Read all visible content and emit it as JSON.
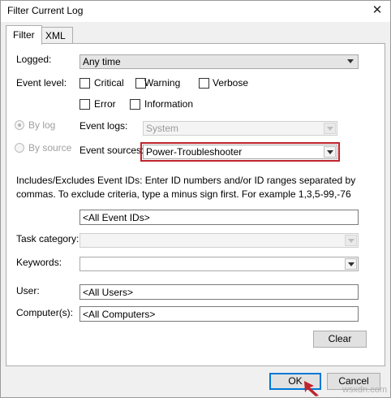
{
  "window": {
    "title": "Filter Current Log"
  },
  "tabs": [
    {
      "label": "Filter"
    },
    {
      "label": "XML"
    }
  ],
  "filter": {
    "logged": {
      "label": "Logged:",
      "value": "Any time"
    },
    "event_level": {
      "label": "Event level:",
      "options": [
        {
          "label": "Critical",
          "checked": false
        },
        {
          "label": "Warning",
          "checked": false
        },
        {
          "label": "Verbose",
          "checked": false
        },
        {
          "label": "Error",
          "checked": false
        },
        {
          "label": "Information",
          "checked": false
        }
      ]
    },
    "by_log": {
      "label": "By log",
      "selected": true
    },
    "by_source": {
      "label": "By source",
      "selected": false
    },
    "event_logs": {
      "label": "Event logs:",
      "value": "System"
    },
    "event_sources": {
      "label": "Event sources:",
      "value": "Power-Troubleshooter"
    },
    "description": "Includes/Excludes Event IDs: Enter ID numbers and/or ID ranges separated by commas. To exclude criteria, type a minus sign first. For example 1,3,5-99,-76",
    "event_ids": {
      "value": "<All Event IDs>"
    },
    "task_category": {
      "label": "Task category:",
      "value": ""
    },
    "keywords": {
      "label": "Keywords:",
      "value": ""
    },
    "user": {
      "label": "User:",
      "value": "<All Users>"
    },
    "computers": {
      "label": "Computer(s):",
      "value": "<All Computers>"
    },
    "clear_label": "Clear"
  },
  "buttons": {
    "ok": "OK",
    "cancel": "Cancel"
  },
  "watermark": "wsxdn.com",
  "colors": {
    "highlight": "#c0242c",
    "focus_border": "#0078d7"
  }
}
